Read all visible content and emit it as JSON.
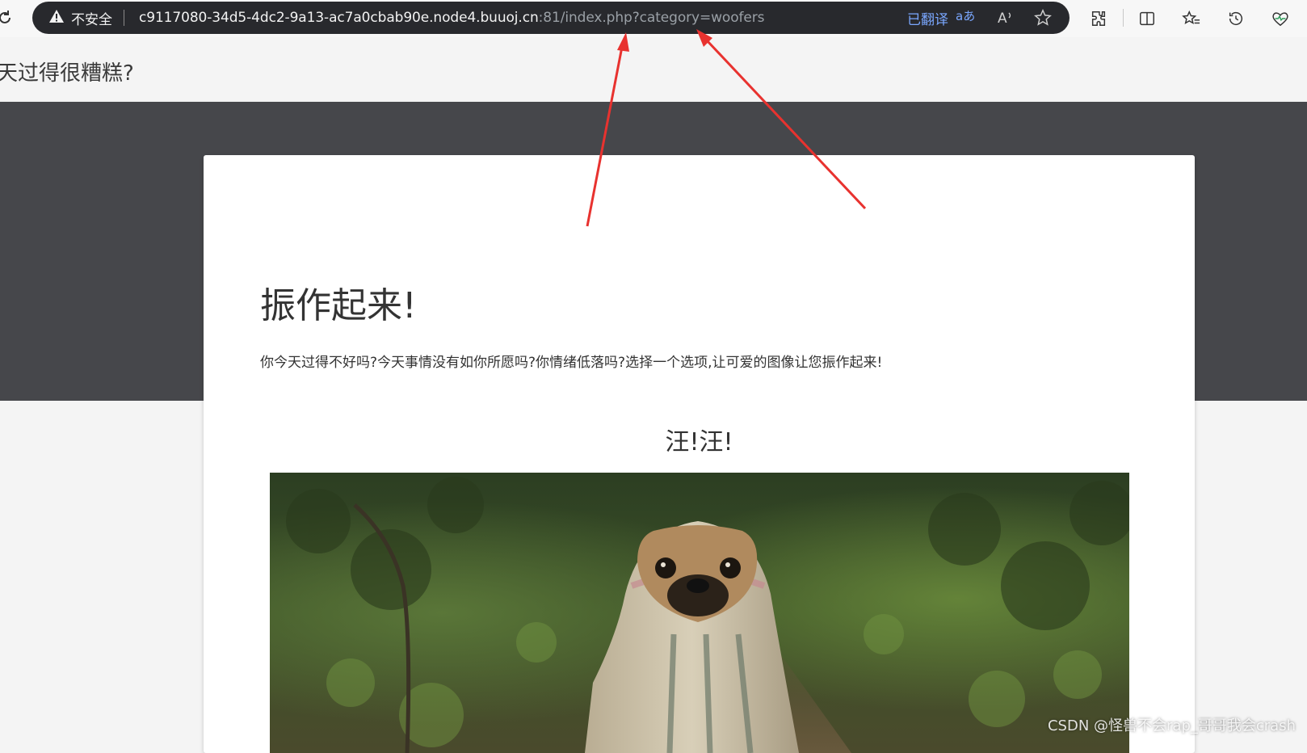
{
  "browser": {
    "security_label": "不安全",
    "url_host": "c9117080-34d5-4dc2-9a13-ac7a0cbab90e.node4.buuoj.cn",
    "url_path": ":81/index.php?category=woofers",
    "translated_label": "已翻译",
    "icons": [
      "reload-icon",
      "warning-icon",
      "translate-icon",
      "read-aloud-icon",
      "star-icon",
      "extensions-icon",
      "split-screen-icon",
      "favorites-icon",
      "history-icon",
      "health-icon"
    ]
  },
  "page": {
    "site_title": "天过得很糟糕?",
    "heading": "振作起来!",
    "description": "你今天过得不好吗?今天事情没有如你所愿吗?你情绪低落吗?选择一个选项,让可爱的图像让您振作起来!",
    "subheading": "汪!汪!"
  },
  "watermark": "CSDN @怪兽不会rap_哥哥我会crash",
  "colors": {
    "address_bar": "#28292d",
    "hero_band": "#46474b",
    "arrow": "#e8322f",
    "translated": "#7aa7ff"
  }
}
